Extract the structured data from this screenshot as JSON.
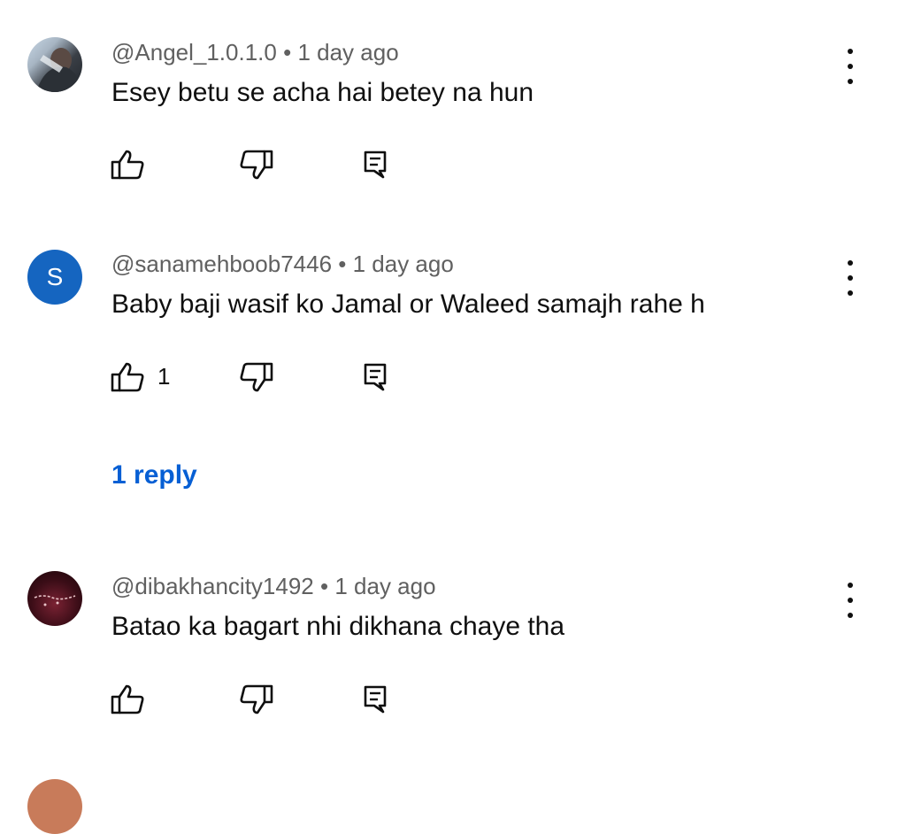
{
  "comments": [
    {
      "handle": "@Angel_1.0.1.0",
      "separator": "•",
      "time": "1 day ago",
      "text": "Esey betu se acha hai betey na hun",
      "like_count": "",
      "avatar_letter": ""
    },
    {
      "handle": "@sanamehboob7446",
      "separator": "•",
      "time": "1 day ago",
      "text": "Baby baji wasif ko Jamal or Waleed samajh rahe h",
      "like_count": "1",
      "avatar_letter": "S",
      "replies_label": "1 reply"
    },
    {
      "handle": "@dibakhancity1492",
      "separator": "•",
      "time": "1 day ago",
      "text": "Batao ka bagart nhi dikhana chaye tha",
      "like_count": "",
      "avatar_letter": ""
    }
  ],
  "icons": {
    "like": "thumbs-up-icon",
    "dislike": "thumbs-down-icon",
    "reply": "reply-icon",
    "more": "more-vertical-icon"
  },
  "colors": {
    "link": "#065fd4",
    "meta": "#606060",
    "text": "#0f0f0f",
    "avatar_s": "#1565c0"
  }
}
